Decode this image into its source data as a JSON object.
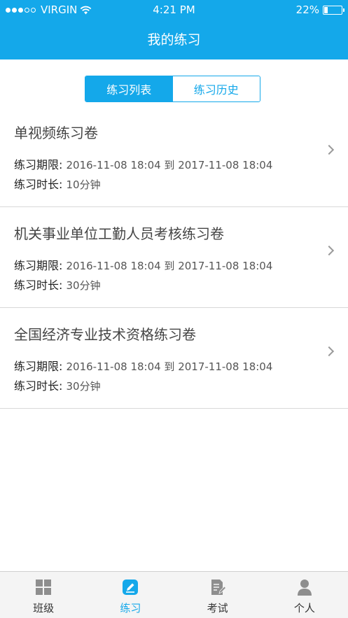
{
  "status": {
    "carrier": "VIRGIN",
    "time": "4:21 PM",
    "battery": "22%",
    "battery_level": 0.22
  },
  "header": {
    "title": "我的练习"
  },
  "segment": {
    "tabs": [
      {
        "label": "练习列表"
      },
      {
        "label": "练习历史"
      }
    ]
  },
  "items": [
    {
      "title": "单视频练习卷",
      "period_label": "练习期限:",
      "period": "2016-11-08 18:04 到 2017-11-08 18:04",
      "duration_label": "练习时长:",
      "duration": "10分钟"
    },
    {
      "title": "机关事业单位工勤人员考核练习卷",
      "period_label": "练习期限:",
      "period": "2016-11-08 18:04 到 2017-11-08 18:04",
      "duration_label": "练习时长:",
      "duration": "30分钟"
    },
    {
      "title": "全国经济专业技术资格练习卷",
      "period_label": "练习期限:",
      "period": "2016-11-08 18:04 到 2017-11-08 18:04",
      "duration_label": "练习时长:",
      "duration": "30分钟"
    }
  ],
  "tabbar": {
    "tabs": [
      {
        "label": "班级",
        "icon": "grid-icon"
      },
      {
        "label": "练习",
        "icon": "edit-icon"
      },
      {
        "label": "考试",
        "icon": "document-pen-icon"
      },
      {
        "label": "个人",
        "icon": "person-icon"
      }
    ]
  },
  "colors": {
    "accent": "#14a8ea",
    "tab_inactive": "#9b9b9b"
  }
}
